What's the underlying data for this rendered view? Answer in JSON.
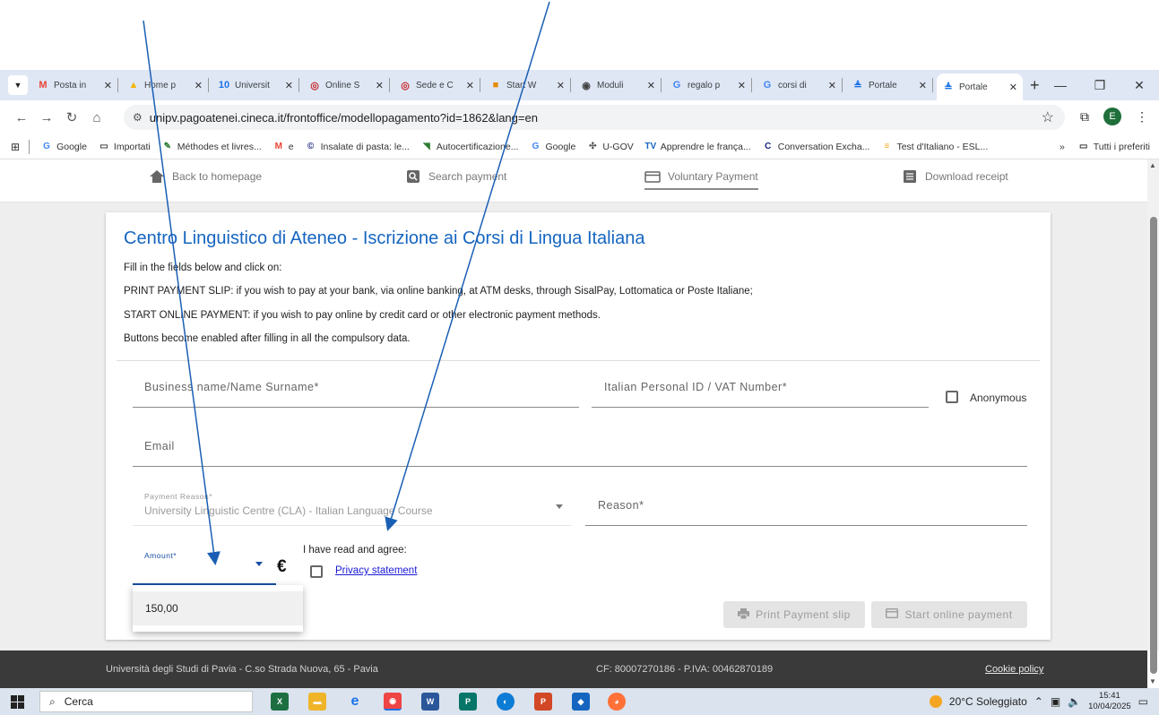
{
  "browser": {
    "tabs": [
      {
        "label": "Posta in",
        "icon": "gmail-icon",
        "color": "#ea4335",
        "glyph": "M"
      },
      {
        "label": "Home p",
        "icon": "drive-icon",
        "color": "#f4b400",
        "glyph": "▲"
      },
      {
        "label": "Universit",
        "icon": "calendar-icon",
        "color": "#1a73e8",
        "glyph": "10"
      },
      {
        "label": "Online S",
        "icon": "university-seal-icon",
        "color": "#c62828",
        "glyph": "◎"
      },
      {
        "label": "Sede e C",
        "icon": "university-seal-icon",
        "color": "#c62828",
        "glyph": "◎"
      },
      {
        "label": "Start W",
        "icon": "start-icon",
        "color": "#e68a00",
        "glyph": "■"
      },
      {
        "label": "Moduli",
        "icon": "globe-icon",
        "color": "#444444",
        "glyph": "◉"
      },
      {
        "label": "regalo p",
        "icon": "google-icon",
        "color": "#4285f4",
        "glyph": "G"
      },
      {
        "label": "corsi di",
        "icon": "google-icon",
        "color": "#4285f4",
        "glyph": "G"
      },
      {
        "label": "Portale",
        "icon": "portal-icon",
        "color": "#1a73e8",
        "glyph": "≜"
      },
      {
        "label": "Portale",
        "icon": "portal-icon",
        "color": "#1a73e8",
        "glyph": "≜",
        "active": true
      }
    ],
    "url": "unipv.pagoatenei.cineca.it/frontoffice/modellopagamento?id=1862&lang=en",
    "profile_initial": "E",
    "bookmarks": [
      {
        "label": "Google",
        "icon": "google-icon",
        "glyph": "G",
        "color": "#4285f4"
      },
      {
        "label": "Importati",
        "icon": "folder-icon",
        "glyph": "▭",
        "color": "#444444"
      },
      {
        "label": "Méthodes et livres...",
        "icon": "bookmark-icon",
        "glyph": "✎",
        "color": "#2e7d32"
      },
      {
        "label": "e",
        "icon": "gmail-icon",
        "glyph": "M",
        "color": "#ea4335"
      },
      {
        "label": "Insalate di pasta: le...",
        "icon": "recipe-icon",
        "glyph": "©",
        "color": "#1a237e"
      },
      {
        "label": "Autocertificazione...",
        "icon": "flag-icon",
        "glyph": "◥",
        "color": "#2e7d32"
      },
      {
        "label": "Google",
        "icon": "google-icon",
        "glyph": "G",
        "color": "#4285f4"
      },
      {
        "label": "U-GOV",
        "icon": "ugov-icon",
        "glyph": "✣",
        "color": "#555555"
      },
      {
        "label": "Apprendre le frança...",
        "icon": "tv5-icon",
        "glyph": "TV",
        "color": "#1565c0"
      },
      {
        "label": "Conversation Excha...",
        "icon": "conversation-icon",
        "glyph": "C",
        "color": "#1a237e"
      },
      {
        "label": "Test d'Italiano - ESL...",
        "icon": "list-icon",
        "glyph": "≡",
        "color": "#f9a825"
      }
    ],
    "bookmarks_more": "»",
    "all_bookmarks": "Tutti i preferiti"
  },
  "page_nav": {
    "home": "Back to homepage",
    "search": "Search payment",
    "voluntary": "Voluntary Payment",
    "download": "Download receipt"
  },
  "form": {
    "title": "Centro Linguistico di Ateneo - Iscrizione ai Corsi di Lingua Italiana",
    "instructions": [
      "Fill in the fields below and click on:",
      "PRINT PAYMENT SLIP: if you wish to pay at your bank, via online banking, at ATM desks, through SisalPay, Lottomatica or Poste Italiane;",
      "START ONLINE PAYMENT: if you wish to pay online by credit card or other electronic payment methods.",
      "Buttons become enabled after filling in all the compulsory data."
    ],
    "business_name_label": "Business name/Name Surname*",
    "personal_id_label": "Italian Personal ID / VAT Number*",
    "anonymous_label": "Anonymous",
    "email_label": "Email",
    "payment_reason_label": "Payment Reason*",
    "payment_reason_value": "University Linguistic Centre (CLA) - Italian Language Course",
    "reason_label": "Reason*",
    "amount_label": "Amount*",
    "currency": "€",
    "agree_text": "I have read and agree:",
    "privacy_link": "Privacy statement",
    "print_button": "Print Payment slip",
    "online_button": "Start online payment",
    "amount_options": [
      "150,00"
    ]
  },
  "footer": {
    "university": "Università degli Studi di Pavia - C.so Strada Nuova, 65 - Pavia",
    "codes": "CF: 80007270186 - P.IVA: 00462870189",
    "cookie": "Cookie policy"
  },
  "taskbar": {
    "search_placeholder": "Cerca",
    "weather": "20°C Soleggiato",
    "time": "15:41",
    "date": "10/04/2025"
  }
}
